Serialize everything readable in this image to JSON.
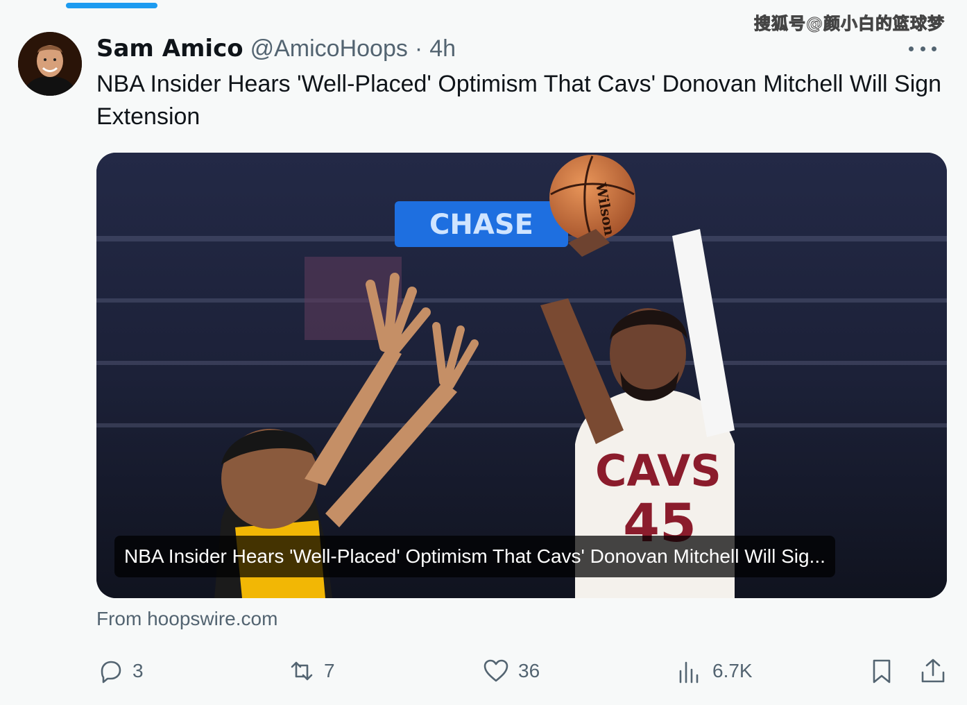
{
  "watermark": "搜狐号@颜小白的篮球梦",
  "tweet": {
    "display_name": "Sam Amico",
    "handle": "@AmicoHoops",
    "separator": "·",
    "time": "4h",
    "text": "NBA Insider Hears 'Well-Placed' Optimism That Cavs' Donovan Mitchell Will Sign Extension"
  },
  "card": {
    "title": "NBA Insider Hears 'Well-Placed' Optimism That Cavs' Donovan Mitchell Will Sig...",
    "source": "From hoopswire.com",
    "photo_texts": {
      "arena_sign": "CHASE",
      "jersey_team": "CAVS",
      "jersey_number": "45",
      "ball_brand": "Wilson"
    }
  },
  "actions": {
    "replies": "3",
    "reposts": "7",
    "likes": "36",
    "views": "6.7K"
  },
  "colors": {
    "accent": "#1d9bf0",
    "muted": "#536471",
    "text": "#0f1419",
    "background": "#f7f9f9"
  }
}
